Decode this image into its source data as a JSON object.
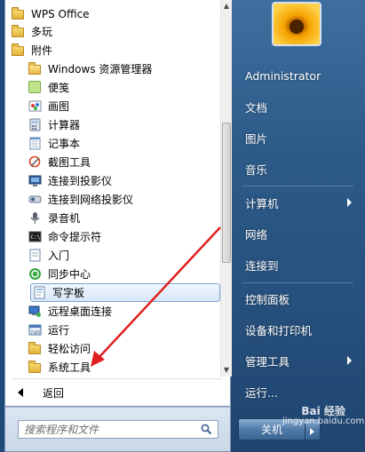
{
  "programs": {
    "top_items": [
      {
        "label": "WPS Office",
        "icon": "folder-icon"
      },
      {
        "label": "多玩",
        "icon": "folder-icon"
      },
      {
        "label": "附件",
        "icon": "folder-icon"
      }
    ],
    "accessories": [
      {
        "label": "Windows 资源管理器",
        "icon": "explorer-icon"
      },
      {
        "label": "便笺",
        "icon": "sticky-notes-icon"
      },
      {
        "label": "画图",
        "icon": "paint-icon"
      },
      {
        "label": "计算器",
        "icon": "calculator-icon"
      },
      {
        "label": "记事本",
        "icon": "notepad-icon"
      },
      {
        "label": "截图工具",
        "icon": "snipping-tool-icon"
      },
      {
        "label": "连接到投影仪",
        "icon": "projector-icon"
      },
      {
        "label": "连接到网络投影仪",
        "icon": "network-projector-icon"
      },
      {
        "label": "录音机",
        "icon": "sound-recorder-icon"
      },
      {
        "label": "命令提示符",
        "icon": "command-prompt-icon"
      },
      {
        "label": "入门",
        "icon": "getting-started-icon"
      },
      {
        "label": "同步中心",
        "icon": "sync-center-icon"
      },
      {
        "label": "写字板",
        "icon": "wordpad-icon"
      },
      {
        "label": "远程桌面连接",
        "icon": "remote-desktop-icon"
      },
      {
        "label": "运行",
        "icon": "run-icon"
      },
      {
        "label": "轻松访问",
        "icon": "folder-icon"
      },
      {
        "label": "系统工具",
        "icon": "folder-icon"
      }
    ],
    "highlighted_index": 12
  },
  "back_label": "返回",
  "search": {
    "placeholder": "搜索程序和文件"
  },
  "right_pane": {
    "user": "Administrator",
    "items": [
      {
        "label": "文档"
      },
      {
        "label": "图片"
      },
      {
        "label": "音乐"
      },
      {
        "label": "计算机"
      },
      {
        "label": "网络"
      },
      {
        "label": "连接到"
      },
      {
        "label": "控制面板"
      },
      {
        "label": "设备和打印机"
      },
      {
        "label": "管理工具"
      },
      {
        "label": "运行..."
      }
    ],
    "shutdown_label": "关机"
  },
  "watermark": {
    "line1": "Bai 经验",
    "line2": "jingyan.baidu.com"
  },
  "colors": {
    "highlight": "#d7e7f8",
    "annotation_arrow": "#e02020",
    "right_pane": "#2c5a88"
  }
}
